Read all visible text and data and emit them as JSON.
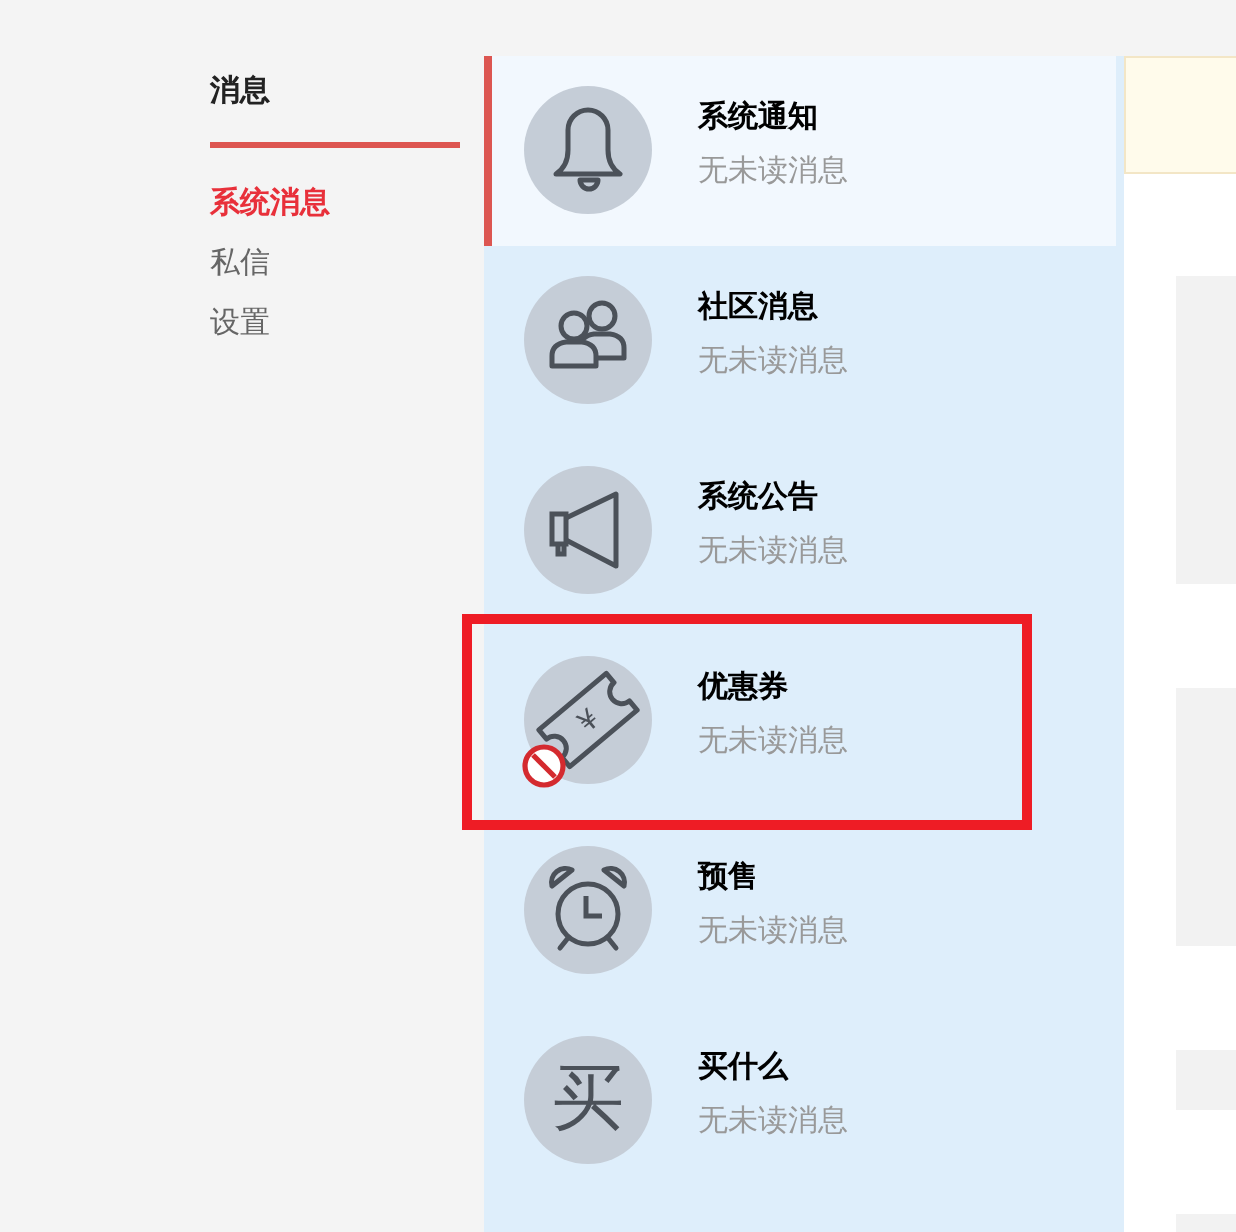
{
  "sidebar": {
    "title": "消息",
    "items": [
      {
        "label": "系统消息",
        "selected": true
      },
      {
        "label": "私信",
        "selected": false
      },
      {
        "label": "设置",
        "selected": false
      }
    ]
  },
  "message_types": [
    {
      "kind": "bell",
      "title": "系统通知",
      "status": "无未读消息",
      "selected": true,
      "highlighted": false,
      "blocked": false
    },
    {
      "kind": "people",
      "title": "社区消息",
      "status": "无未读消息",
      "selected": false,
      "highlighted": false,
      "blocked": false
    },
    {
      "kind": "megaphone",
      "title": "系统公告",
      "status": "无未读消息",
      "selected": false,
      "highlighted": false,
      "blocked": false
    },
    {
      "kind": "ticket",
      "glyph": "¥",
      "title": "优惠券",
      "status": "无未读消息",
      "selected": false,
      "highlighted": true,
      "blocked": true
    },
    {
      "kind": "alarm",
      "title": "预售",
      "status": "无未读消息",
      "selected": false,
      "highlighted": false,
      "blocked": false
    },
    {
      "kind": "character",
      "glyph": "买",
      "title": "买什么",
      "status": "无未读消息",
      "selected": false,
      "highlighted": false,
      "blocked": false
    }
  ]
}
